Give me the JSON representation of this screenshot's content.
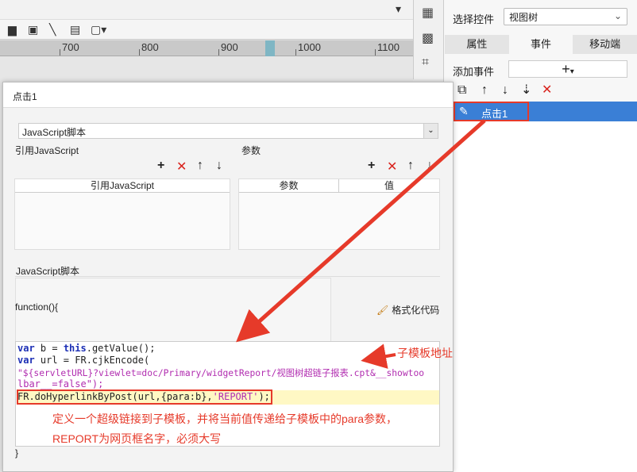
{
  "ruler": {
    "labels": [
      "700",
      "800",
      "900",
      "1000",
      "1100"
    ]
  },
  "right_panel": {
    "select_label": "选择控件",
    "select_value": "视图树",
    "tabs": [
      {
        "label": "属性"
      },
      {
        "label": "事件"
      },
      {
        "label": "移动端"
      }
    ],
    "add_event_label": "添加事件",
    "add_event_btn": "+",
    "event_item": "点击1"
  },
  "dialog": {
    "title": "点击1",
    "script_type": "JavaScript脚本",
    "ref_js_label": "引用JavaScript",
    "ref_js_col": "引用JavaScript",
    "params_label": "参数",
    "param_col": "参数",
    "value_col": "值",
    "js_script_label": "JavaScript脚本",
    "fn_open": "function(){",
    "format_btn": "格式化代码",
    "fn_close": "}",
    "code": {
      "l1a": "var",
      "l1b": " b = ",
      "l1c": "this",
      "l1d": ".getValue();",
      "l2a": "var",
      "l2b": " url = FR.cjkEncode(",
      "l3": "\"${servletURL}?viewlet=doc/Primary/widgetReport/视图树超链子报表.cpt&__showtoo",
      "l4": "lbar__=false\");",
      "l5a": "FR.doHyperlinkByPost(url,{para:b},",
      "l5b": "'REPORT'",
      "l5c": ");"
    }
  },
  "annotations": {
    "sub_template_addr": "子模板地址",
    "note_line1": "定义一个超级链接到子模板，并将当前值传递给子模板中的para参数，",
    "note_line2": "REPORT为网页框名字，必须大写"
  },
  "colors": {
    "accent": "#3a7fd6",
    "annotation": "#e63a2a",
    "delete": "#d9231d"
  }
}
